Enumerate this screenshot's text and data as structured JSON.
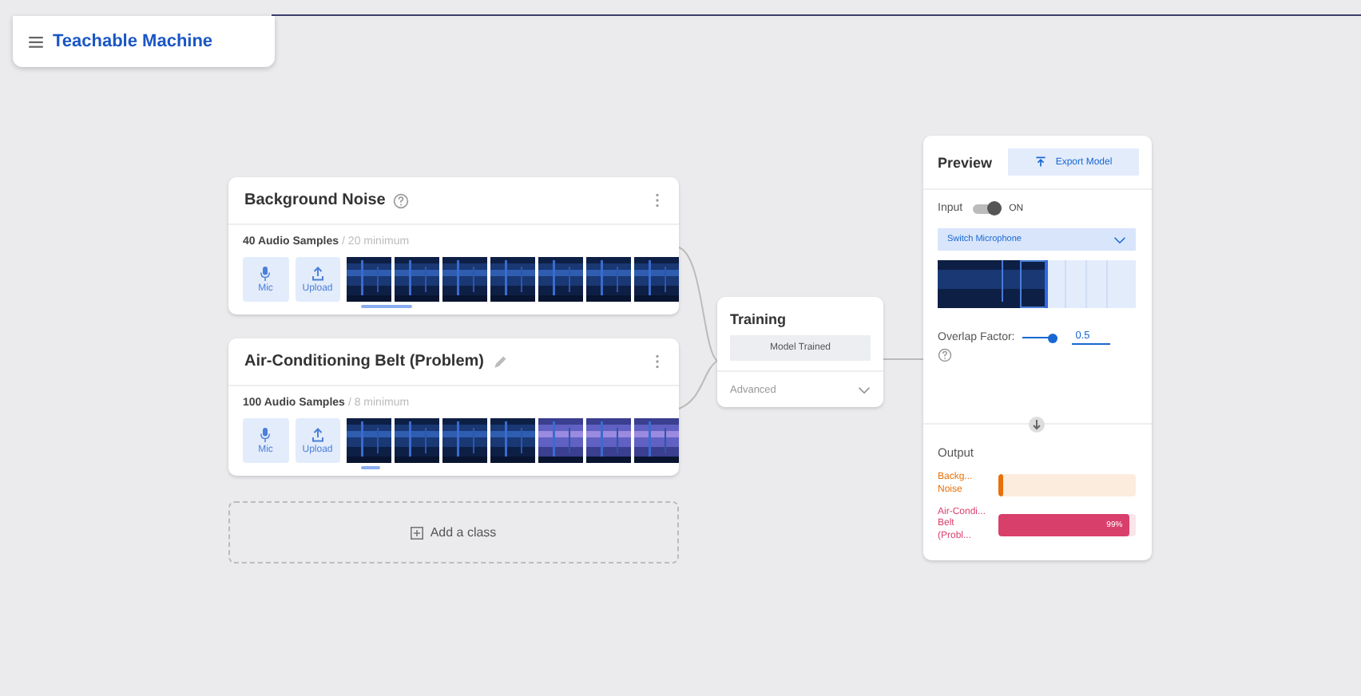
{
  "app": {
    "title": "Teachable Machine"
  },
  "classes": [
    {
      "name": "Background Noise",
      "title_icon": {
        "kind": "help"
      },
      "samples": "40 Audio Samples",
      "minimum": "/ 20 minimum",
      "buttons": [
        "Mic",
        "Upload"
      ],
      "thumbnails": [
        {
          "kind": "dark"
        },
        {
          "kind": "dark"
        },
        {
          "kind": "dark"
        },
        {
          "kind": "dark"
        },
        {
          "kind": "dark"
        },
        {
          "kind": "dark"
        },
        {
          "kind": "dark"
        }
      ]
    },
    {
      "name": "Air-Conditioning Belt (Problem)",
      "title_icon": {
        "kind": "edit"
      },
      "samples": "100 Audio Samples",
      "minimum": "/ 8 minimum",
      "buttons": [
        "Mic",
        "Upload"
      ],
      "thumbnails": [
        {
          "kind": "dark"
        },
        {
          "kind": "dark"
        },
        {
          "kind": "dark"
        },
        {
          "kind": "dark"
        },
        {
          "kind": "purple"
        },
        {
          "kind": "purple"
        },
        {
          "kind": "purple"
        }
      ]
    }
  ],
  "add_class": "Add a class",
  "training": {
    "title": "Training",
    "button": "Model Trained",
    "advanced": "Advanced"
  },
  "preview": {
    "title": "Preview",
    "export": "Export Model",
    "input_label": "Input",
    "input_on": true,
    "input_state": "ON",
    "microphone": "Switch Microphone",
    "overlap_label": "Overlap Factor:",
    "overlap": {
      "level": 0.85
    },
    "overlap_value": "0.5",
    "output_label": "Output",
    "outputs": [
      {
        "label": "Backg... Noise",
        "level": 0.03,
        "color": "#e8710a"
      },
      {
        "label": "Air-Condi... Belt (Probl...",
        "level": 0.95,
        "color": "#d93f6b",
        "reading": "99%"
      }
    ]
  }
}
